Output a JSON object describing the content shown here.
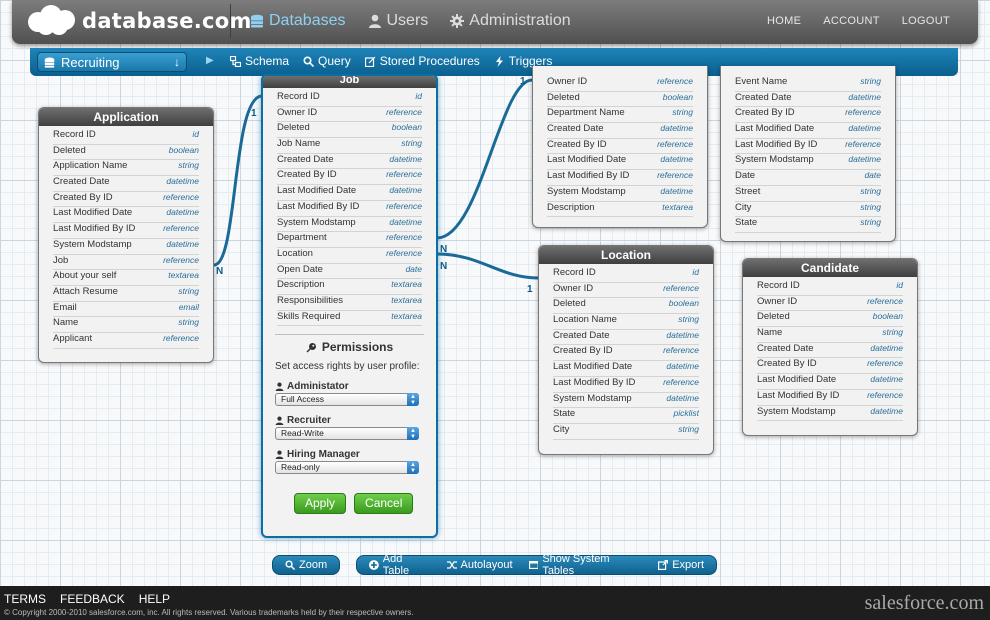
{
  "header": {
    "logo_text": "database.com",
    "nav": [
      {
        "label": "Databases",
        "icon": "database-icon",
        "active": true
      },
      {
        "label": "Users",
        "icon": "user-icon",
        "active": false
      },
      {
        "label": "Administration",
        "icon": "gear-icon",
        "active": false
      }
    ],
    "right_links": [
      "HOME",
      "ACCOUNT",
      "LOGOUT"
    ]
  },
  "toolbar": {
    "database_selected": "Recruiting",
    "items": [
      {
        "label": "Schema",
        "icon": "schema-icon"
      },
      {
        "label": "Query",
        "icon": "search-icon"
      },
      {
        "label": "Stored Procedures",
        "icon": "edit-icon"
      },
      {
        "label": "Triggers",
        "icon": "bolt-icon"
      }
    ]
  },
  "tables": {
    "application": {
      "title": "Application",
      "fields": [
        [
          "Record ID",
          "id"
        ],
        [
          "Deleted",
          "boolean"
        ],
        [
          "Application Name",
          "string"
        ],
        [
          "Created Date",
          "datetime"
        ],
        [
          "Created By ID",
          "reference"
        ],
        [
          "Last Modified Date",
          "datetime"
        ],
        [
          "Last Modified By ID",
          "reference"
        ],
        [
          "System Modstamp",
          "datetime"
        ],
        [
          "Job",
          "reference"
        ],
        [
          "About your self",
          "textarea"
        ],
        [
          "Attach Resume",
          "string"
        ],
        [
          "Email",
          "email"
        ],
        [
          "Name",
          "string"
        ],
        [
          "Applicant",
          "reference"
        ]
      ]
    },
    "job": {
      "title": "Job",
      "fields": [
        [
          "Record ID",
          "id"
        ],
        [
          "Owner ID",
          "reference"
        ],
        [
          "Deleted",
          "boolean"
        ],
        [
          "Job Name",
          "string"
        ],
        [
          "Created Date",
          "datetime"
        ],
        [
          "Created By ID",
          "reference"
        ],
        [
          "Last Modified Date",
          "datetime"
        ],
        [
          "Last Modified By ID",
          "reference"
        ],
        [
          "System Modstamp",
          "datetime"
        ],
        [
          "Department",
          "reference"
        ],
        [
          "Location",
          "reference"
        ],
        [
          "Open Date",
          "date"
        ],
        [
          "Description",
          "textarea"
        ],
        [
          "Responsibilities",
          "textarea"
        ],
        [
          "Skills Required",
          "textarea"
        ]
      ],
      "permissions": {
        "title": "Permissions",
        "description": "Set access rights by user profile:",
        "roles": [
          {
            "label": "Administator",
            "value": "Full Access"
          },
          {
            "label": "Recruiter",
            "value": "Read-Write"
          },
          {
            "label": "Hiring Manager",
            "value": "Read-only"
          }
        ],
        "apply_label": "Apply",
        "cancel_label": "Cancel"
      }
    },
    "department": {
      "fields": [
        [
          "Owner ID",
          "reference"
        ],
        [
          "Deleted",
          "boolean"
        ],
        [
          "Department Name",
          "string"
        ],
        [
          "Created Date",
          "datetime"
        ],
        [
          "Created By ID",
          "reference"
        ],
        [
          "Last Modified Date",
          "datetime"
        ],
        [
          "Last Modified By ID",
          "reference"
        ],
        [
          "System Modstamp",
          "datetime"
        ],
        [
          "Description",
          "textarea"
        ]
      ]
    },
    "event": {
      "fields": [
        [
          "Event Name",
          "string"
        ],
        [
          "Created Date",
          "datetime"
        ],
        [
          "Created By ID",
          "reference"
        ],
        [
          "Last Modified Date",
          "datetime"
        ],
        [
          "Last Modified By ID",
          "reference"
        ],
        [
          "System Modstamp",
          "datetime"
        ],
        [
          "Date",
          "date"
        ],
        [
          "Street",
          "string"
        ],
        [
          "City",
          "string"
        ],
        [
          "State",
          "string"
        ]
      ]
    },
    "location": {
      "title": "Location",
      "fields": [
        [
          "Record ID",
          "id"
        ],
        [
          "Owner ID",
          "reference"
        ],
        [
          "Deleted",
          "boolean"
        ],
        [
          "Location Name",
          "string"
        ],
        [
          "Created Date",
          "datetime"
        ],
        [
          "Created By ID",
          "reference"
        ],
        [
          "Last Modified Date",
          "datetime"
        ],
        [
          "Last Modified By ID",
          "reference"
        ],
        [
          "System Modstamp",
          "datetime"
        ],
        [
          "State",
          "picklist"
        ],
        [
          "City",
          "string"
        ]
      ]
    },
    "candidate": {
      "title": "Candidate",
      "fields": [
        [
          "Record ID",
          "id"
        ],
        [
          "Owner ID",
          "reference"
        ],
        [
          "Deleted",
          "boolean"
        ],
        [
          "Name",
          "string"
        ],
        [
          "Created Date",
          "datetime"
        ],
        [
          "Created By ID",
          "reference"
        ],
        [
          "Last Modified Date",
          "datetime"
        ],
        [
          "Last Modified By ID",
          "reference"
        ],
        [
          "System Modstamp",
          "datetime"
        ]
      ]
    }
  },
  "connector_labels": {
    "one": "1",
    "many": "N"
  },
  "bottom_toolbar": {
    "zoom_label": "Zoom",
    "items": [
      {
        "label": "Add Table",
        "icon": "plus-icon"
      },
      {
        "label": "Autolayout",
        "icon": "shuffle-icon"
      },
      {
        "label": "Show System Tables",
        "icon": "window-icon"
      },
      {
        "label": "Export",
        "icon": "export-icon"
      }
    ]
  },
  "footer": {
    "links": [
      "TERMS",
      "FEEDBACK",
      "HELP"
    ],
    "copyright": "© Copyright 2000-2010 salesforce.com, inc. All rights reserved. Various trademarks held by their respective owners.",
    "brand": "salesforce.com"
  },
  "colors": {
    "accent": "#0d6ea3",
    "connector": "#1a6a98",
    "header": "#5e5e5e",
    "apply_green": "#4fb02d"
  }
}
